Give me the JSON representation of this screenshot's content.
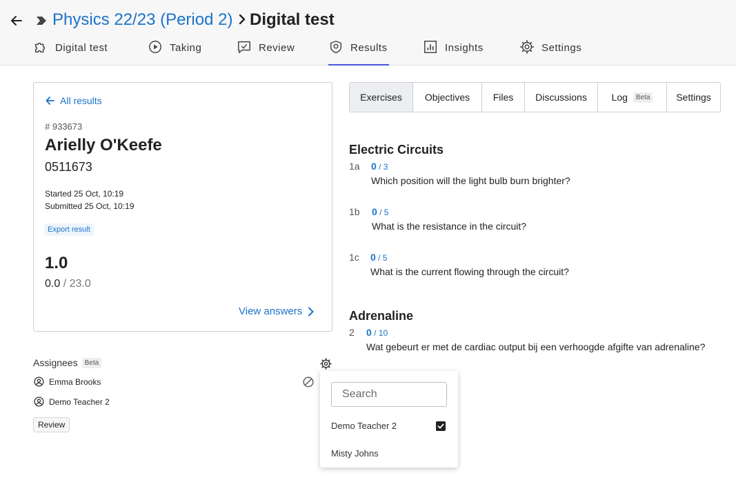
{
  "header": {
    "course": "Physics 22/23 (Period 2)",
    "separator": ">",
    "title": "Digital test"
  },
  "tabs": [
    {
      "label": "Digital test"
    },
    {
      "label": "Taking"
    },
    {
      "label": "Review"
    },
    {
      "label": "Results"
    },
    {
      "label": "Insights"
    },
    {
      "label": "Settings"
    }
  ],
  "result": {
    "all_results": "All results",
    "id": "# 933673",
    "name": "Arielly O'Keefe",
    "number": "0511673",
    "started": "Started 25 Oct, 10:19",
    "submitted": "Submitted 25 Oct, 10:19",
    "export": "Export result",
    "grade": "1.0",
    "score": "0.0",
    "score_max": " / 23.0",
    "view_answers": "View answers"
  },
  "assignees": {
    "label": "Assignees",
    "beta": "Beta",
    "people": [
      "Emma Brooks",
      "Demo Teacher 2"
    ],
    "review": "Review"
  },
  "dropdown": {
    "placeholder": "Search",
    "options": [
      {
        "name": "Demo Teacher 2",
        "checked": true
      },
      {
        "name": "Misty Johns",
        "checked": false
      }
    ]
  },
  "subtabs": [
    "Exercises",
    "Objectives",
    "Files",
    "Discussions",
    "Log",
    "Settings"
  ],
  "subtab_beta": "Beta",
  "sections": [
    {
      "title": "Electric Circuits",
      "exercises": [
        {
          "num": "1a",
          "score": "0",
          "max": " / 3",
          "question": "Which position will the light bulb burn brighter?"
        },
        {
          "num": "1b",
          "score": "0",
          "max": " / 5",
          "question": "What is the resistance in the circuit?"
        },
        {
          "num": "1c",
          "score": "0",
          "max": " / 5",
          "question": "What is the current flowing through the circuit?"
        }
      ]
    },
    {
      "title": "Adrenaline",
      "exercises": [
        {
          "num": "2",
          "score": "0",
          "max": " / 10",
          "question": "Wat gebeurt er met de cardiac output bij een verhoogde afgifte van adrenaline?"
        }
      ]
    }
  ],
  "colors": {
    "link": "#1a73c9",
    "active_tab_underline": "#4a55d8",
    "header_bg": "#f7f7f8"
  }
}
